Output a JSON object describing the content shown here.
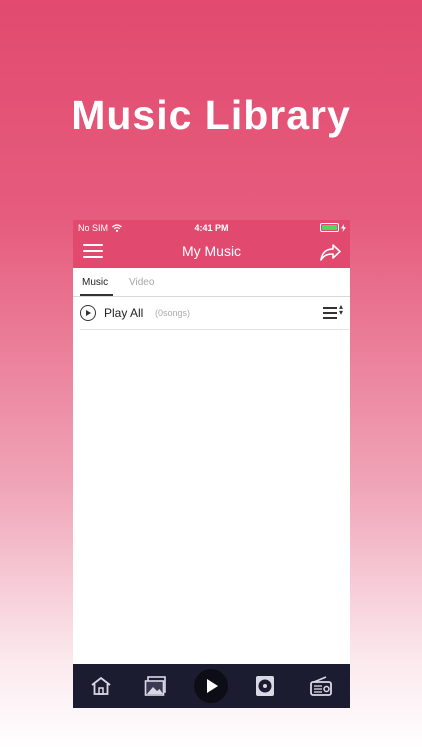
{
  "promo": {
    "title": "Music Library"
  },
  "status_bar": {
    "carrier": "No SIM",
    "time": "4:41 PM",
    "battery_color": "#4cd964"
  },
  "navbar": {
    "title": "My Music",
    "accent": "#e14a6e",
    "menu_icon": "hamburger-menu-icon",
    "share_icon": "share-icon"
  },
  "tabs": [
    {
      "label": "Music",
      "selected": true
    },
    {
      "label": "Video",
      "selected": false
    }
  ],
  "playall": {
    "label": "Play All",
    "count_text": "(0songs)"
  },
  "tabbar": {
    "background": "#1c1c30",
    "items": [
      "home-icon",
      "gallery-icon",
      "play-icon",
      "music-disc-icon",
      "radio-icon"
    ]
  }
}
